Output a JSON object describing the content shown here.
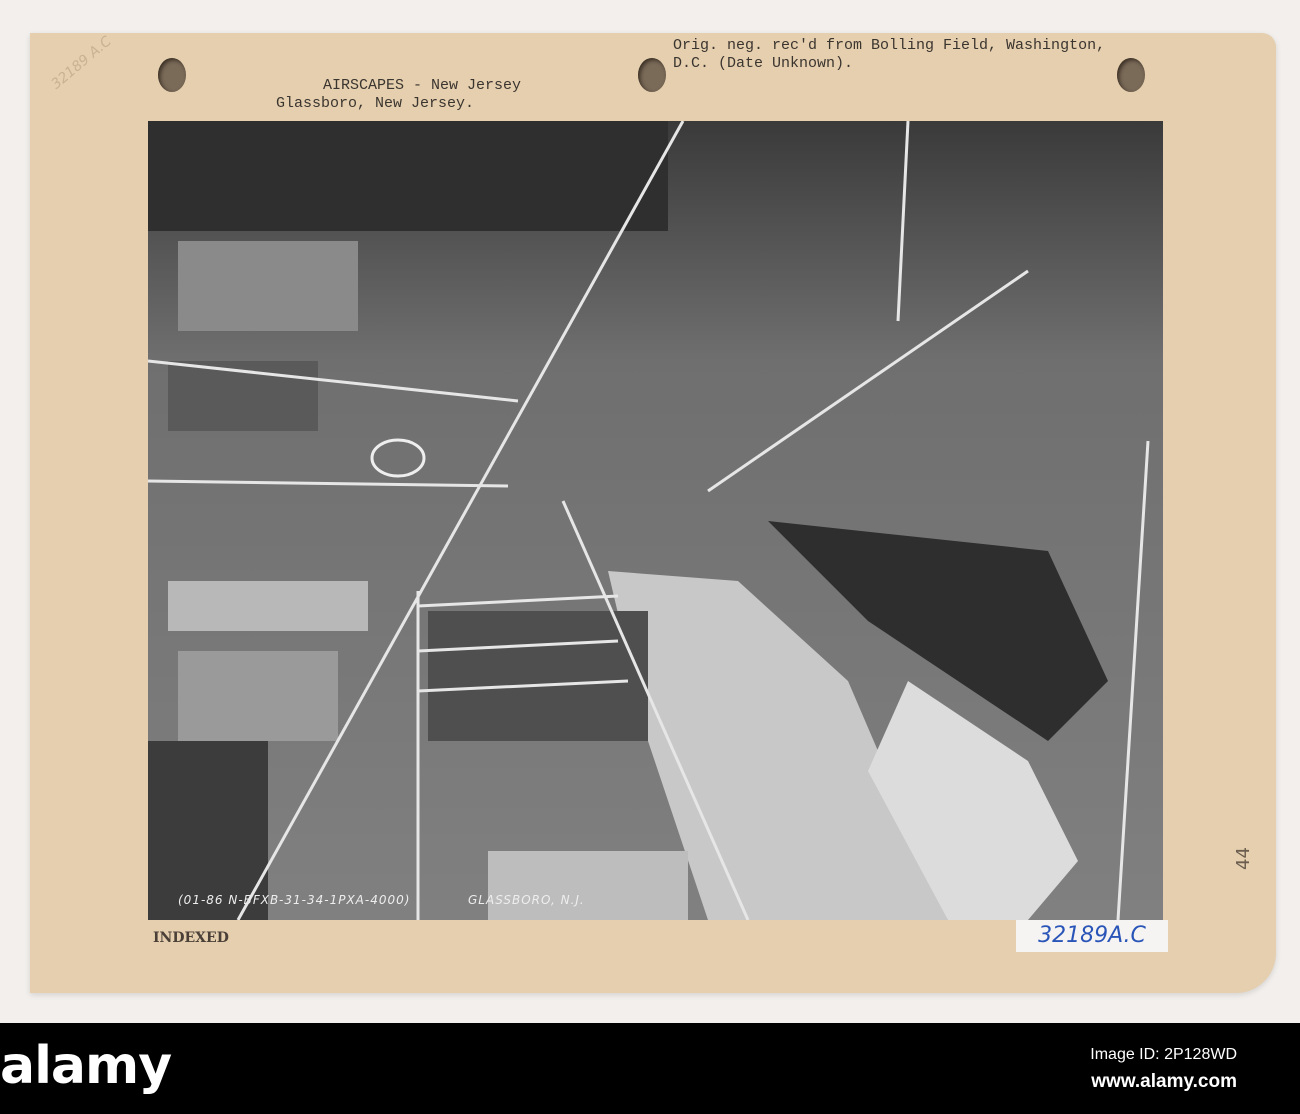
{
  "card": {
    "header_left": [
      "AIRSCAPES - New Jersey",
      "Glassboro, New Jersey."
    ],
    "header_right": [
      "Orig. neg. rec'd from Bolling Field, Washington,",
      "D.C. (Date Unknown)."
    ],
    "pencil_note": "32189 A.C",
    "negative_number": "(01-86 N-BFXB-31-34-1PXA-4000)",
    "photo_location": "GLASSBORO, N.J.",
    "stamp": "INDEXED",
    "catalog_label": "32189A.C",
    "side_mark": "44"
  },
  "footer": {
    "logo": "alamy",
    "image_id": "Image ID: 2P128WD",
    "url": "www.alamy.com"
  }
}
